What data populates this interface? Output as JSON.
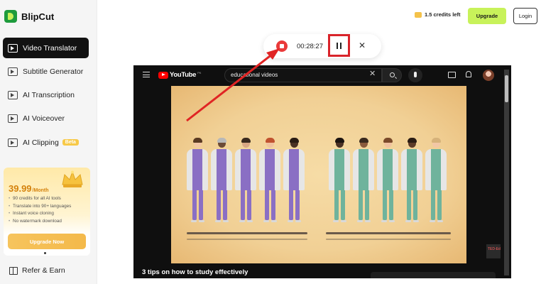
{
  "app": {
    "name": "BlipCut"
  },
  "sidebar": {
    "items": [
      {
        "label": "Video Translator",
        "icon": "video-translate-icon",
        "active": true
      },
      {
        "label": "Subtitle Generator",
        "icon": "subtitle-icon"
      },
      {
        "label": "AI Transcription",
        "icon": "transcription-icon"
      },
      {
        "label": "AI Voiceover",
        "icon": "voiceover-icon"
      },
      {
        "label": "AI Clipping",
        "icon": "clipping-icon",
        "badge": "Beta"
      }
    ],
    "promo": {
      "price": "39.99",
      "period": "/Month",
      "features": [
        "90 credits for all AI tools",
        "Translate into 90+ languages",
        "Instant voice cloning",
        "No watermark download"
      ],
      "button": "Upgrade Now"
    },
    "refer": "Refer & Earn"
  },
  "header": {
    "credits": "1.5 credits left",
    "upgrade": "Upgrade",
    "login": "Login"
  },
  "recorder": {
    "timer": "00:28:27"
  },
  "video": {
    "logo": "YouTube",
    "logo_sup": "PK",
    "search_value": "educational videos",
    "corner_text": "TED-Ed",
    "title": "3 tips on how to study effectively"
  },
  "colors": {
    "annotation_red": "#e02424",
    "lime": "#c8f25a",
    "promo_gold": "#d4810b"
  }
}
